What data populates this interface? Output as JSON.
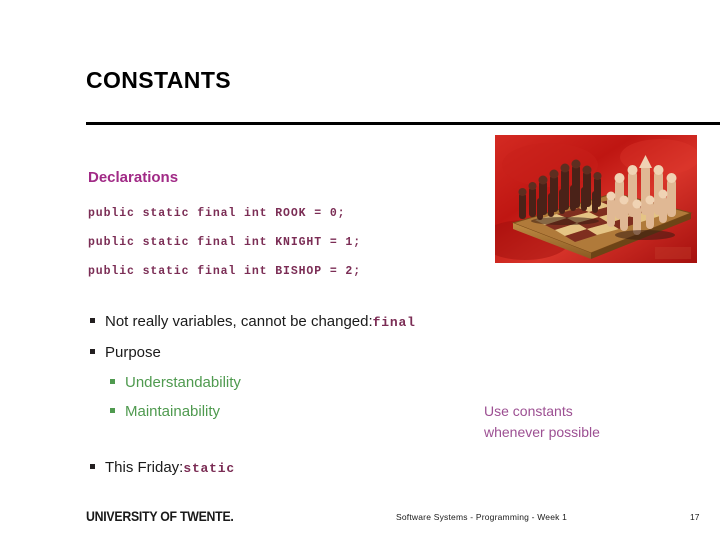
{
  "slide": {
    "title": "CONSTANTS",
    "page_number": "17"
  },
  "declarations": {
    "heading": "Declarations",
    "heading_color": "#a12a86",
    "code_color": "#7b2d55",
    "lines": [
      "public static final int ROOK = 0;",
      "public static final int KNIGHT = 1;",
      "public static final int BISHOP = 2;"
    ]
  },
  "bullets": {
    "not_variables": {
      "text": "Not really variables, cannot be changed: ",
      "code": "final"
    },
    "purpose": {
      "text": "Purpose"
    },
    "sub": [
      {
        "text": "Understandability"
      },
      {
        "text": "Maintainability"
      }
    ],
    "friday": {
      "text": "This Friday: ",
      "code": "static"
    },
    "marker_color_level1": "#231f20",
    "marker_color_level2": "#4f9a4f",
    "level2_text_color": "#4f9a4f"
  },
  "side_note": {
    "line1": "Use constants",
    "line2": "whenever possible",
    "color": "#9c4f92"
  },
  "photo": {
    "alt": "chess-set-photo",
    "background_color": "#c41b18",
    "board_light": "#e8c98a",
    "board_dark": "#8a2b1f",
    "board_edge": "#b07a3a"
  },
  "footer": {
    "logo": "UNIVERSITY OF TWENTE.",
    "center": "Software Systems - Programming - Week 1"
  }
}
